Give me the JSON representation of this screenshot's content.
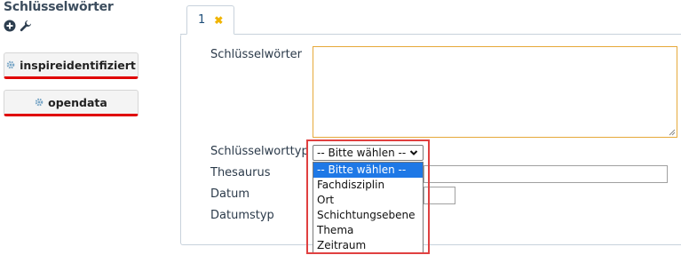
{
  "section": {
    "title": "Schlüsselwörter"
  },
  "tools": {
    "add_icon": "plus-circle-icon",
    "edit_icon": "wrench-icon"
  },
  "keyword_buttons": [
    {
      "label": "inspireidentifiziert",
      "icon": "gear-icon"
    },
    {
      "label": "opendata",
      "icon": "gear-icon"
    }
  ],
  "tab": {
    "label": "1",
    "close_icon": "close-icon"
  },
  "form": {
    "keywords_label": "Schlüsselwörter",
    "keywords_value": "",
    "keyword_type_label": "Schlüsselworttyp",
    "thesaurus_label": "Thesaurus",
    "date_label": "Datum",
    "date_type_label": "Datumstyp"
  },
  "select": {
    "value": "-- Bitte wählen --",
    "options": [
      "-- Bitte wählen --",
      "Fachdisziplin",
      "Ort",
      "Schichtungsebene",
      "Thema",
      "Zeitraum"
    ],
    "selected_index": 0
  },
  "colors": {
    "accent_red": "#e00000",
    "highlight": "#e04040",
    "selected_option": "#1e78e6",
    "textarea_border": "#e6a93a"
  }
}
